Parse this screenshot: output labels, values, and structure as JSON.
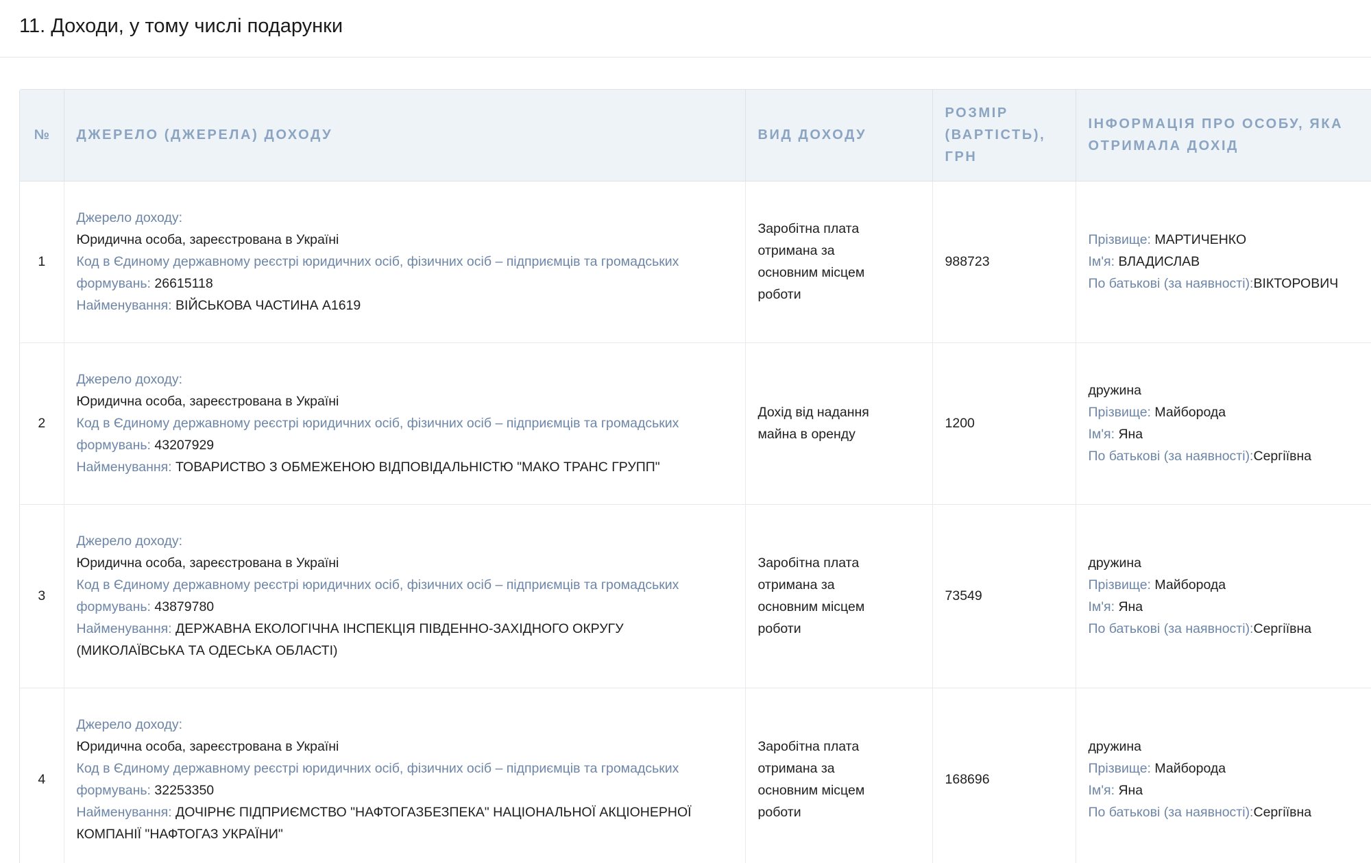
{
  "page": {
    "title": "11. Доходи, у тому числі подарунки"
  },
  "table": {
    "headers": {
      "num": "№",
      "source": "Джерело (джерела) доходу",
      "type": "Вид доходу",
      "amount": "Розмір (вартість), грн",
      "person": "Інформація про особу, яка отримала дохід"
    },
    "labels": {
      "source_header": "Джерело доходу:",
      "code": "Код в Єдиному державному реєстрі юридичних осіб, фізичних осіб – підприємців та громадських формувань:",
      "name": "Найменування:",
      "surname": "Прізвище:",
      "first_name": "Ім'я:",
      "patronymic": "По батькові (за наявності):"
    },
    "rows": [
      {
        "num": "1",
        "entity_type": "Юридична особа, зареєстрована в Україні",
        "code": "26615118",
        "name": "ВІЙСЬКОВА ЧАСТИНА А1619",
        "income_type": "Заробітна плата отримана за основним місцем роботи",
        "amount": "988723",
        "relation": "",
        "surname": "МАРТИЧЕНКО",
        "first_name": "ВЛАДИСЛАВ",
        "patronymic": "ВІКТОРОВИЧ"
      },
      {
        "num": "2",
        "entity_type": "Юридична особа, зареєстрована в Україні",
        "code": "43207929",
        "name": "ТОВАРИСТВО З ОБМЕЖЕНОЮ ВІДПОВІДАЛЬНІСТЮ \"МАКО ТРАНС ГРУПП\"",
        "income_type": "Дохід від надання майна в оренду",
        "amount": "1200",
        "relation": "дружина",
        "surname": "Майборода",
        "first_name": "Яна",
        "patronymic": "Сергіївна"
      },
      {
        "num": "3",
        "entity_type": "Юридична особа, зареєстрована в Україні",
        "code": "43879780",
        "name": "ДЕРЖАВНА ЕКОЛОГІЧНА ІНСПЕКЦІЯ ПІВДЕННО-ЗАХІДНОГО ОКРУГУ (МИКОЛАЇВСЬКА ТА ОДЕСЬКА ОБЛАСТІ)",
        "income_type": "Заробітна плата отримана за основним місцем роботи",
        "amount": "73549",
        "relation": "дружина",
        "surname": "Майборода",
        "first_name": "Яна",
        "patronymic": "Сергіївна"
      },
      {
        "num": "4",
        "entity_type": "Юридична особа, зареєстрована в Україні",
        "code": "32253350",
        "name": "ДОЧІРНЄ ПІДПРИЄМСТВО \"НАФТОГАЗБЕЗПЕКА\" НАЦІОНАЛЬНОЇ АКЦІОНЕРНОЇ КОМПАНІЇ \"НАФТОГАЗ УКРАЇНИ\"",
        "income_type": "Заробітна плата отримана за основним місцем роботи",
        "amount": "168696",
        "relation": "дружина",
        "surname": "Майборода",
        "first_name": "Яна",
        "patronymic": "Сергіївна"
      }
    ]
  }
}
